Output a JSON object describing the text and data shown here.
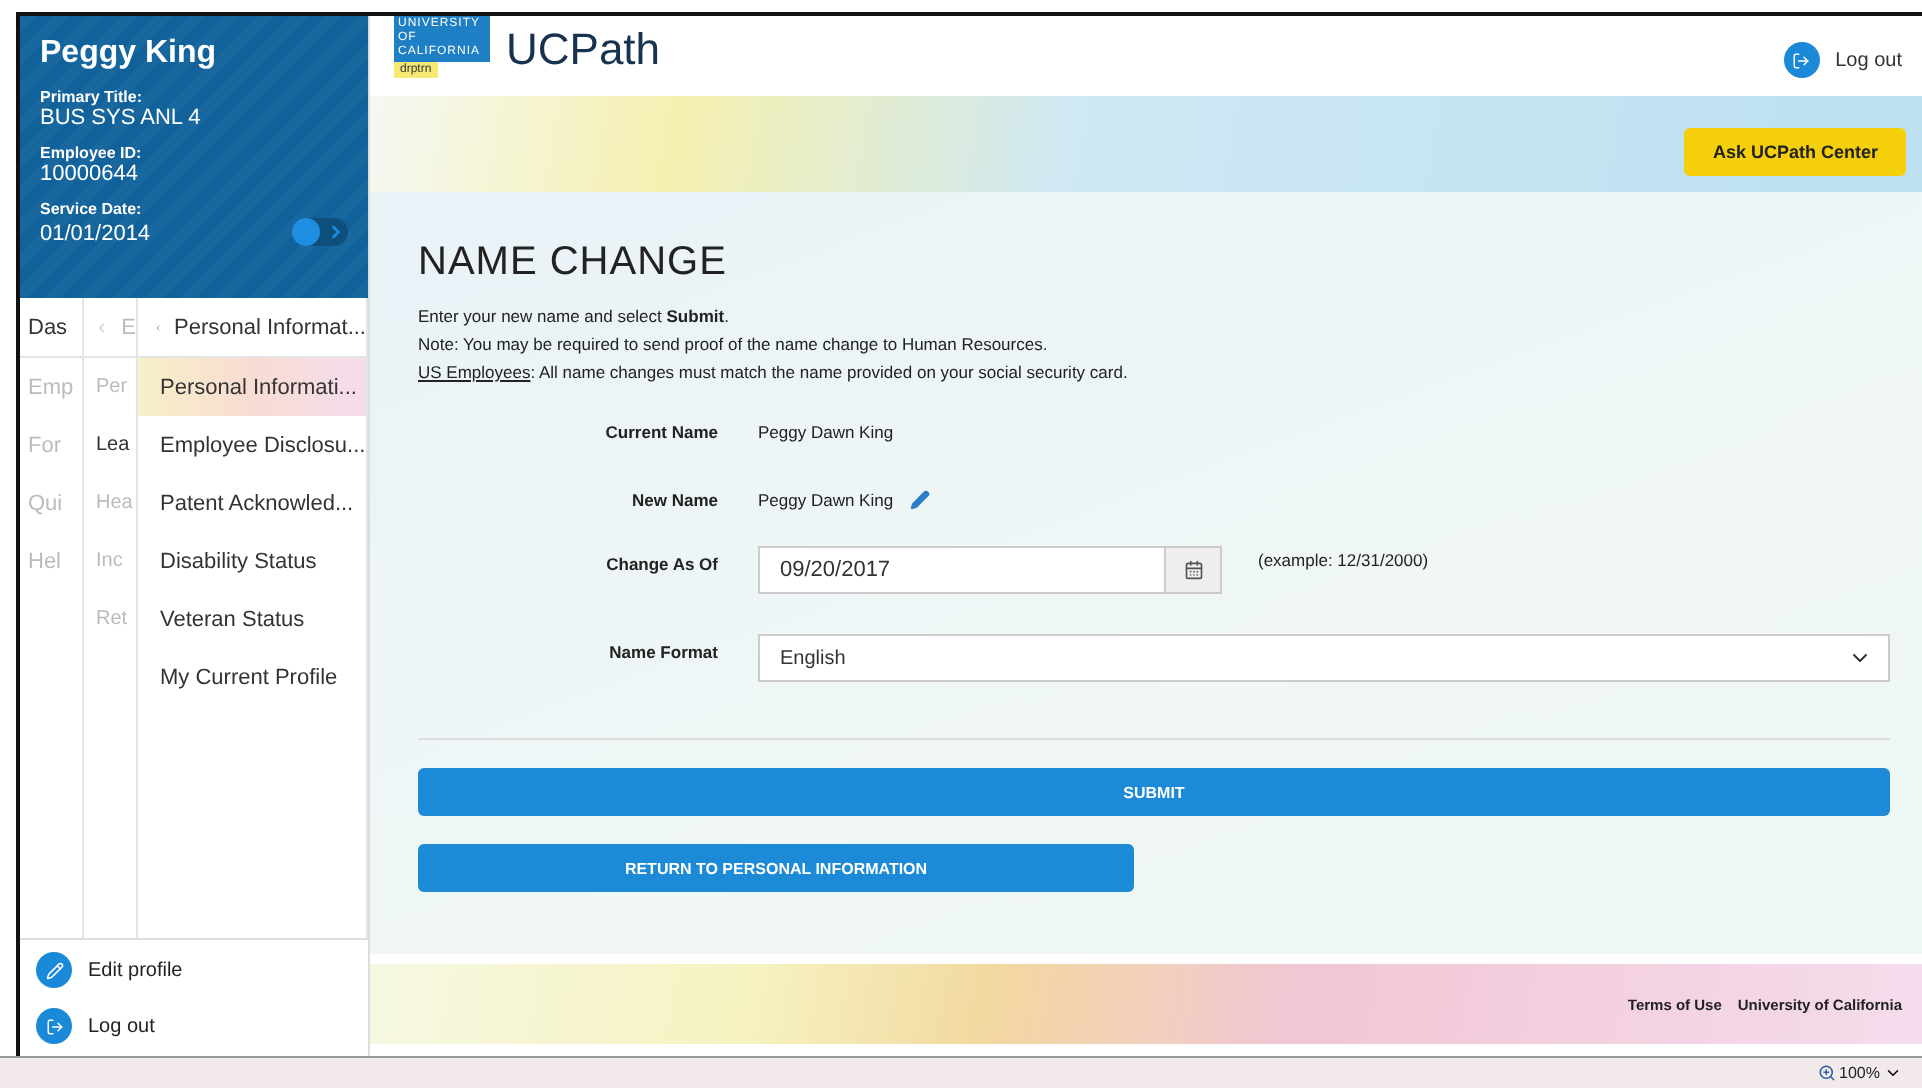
{
  "profile": {
    "name": "Peggy King",
    "fields": [
      {
        "label": "Primary Title:",
        "value": "BUS SYS ANL 4"
      },
      {
        "label": "Employee ID:",
        "value": "10000644"
      },
      {
        "label": "Service Date:",
        "value": "01/01/2014"
      }
    ],
    "toggle": {
      "on": false
    }
  },
  "nav": {
    "columns": [
      {
        "header": "Das",
        "items": [
          {
            "label": "Emp",
            "disabled": true
          },
          {
            "label": "For",
            "disabled": true
          },
          {
            "label": "Qui",
            "disabled": true
          },
          {
            "label": "Hel",
            "disabled": true
          }
        ]
      },
      {
        "header": "E",
        "items": [
          {
            "label": "Per",
            "disabled": true
          },
          {
            "label": "Lea",
            "disabled": false
          },
          {
            "label": "Hea",
            "disabled": true
          },
          {
            "label": "Inc",
            "disabled": true
          },
          {
            "label": "Ret",
            "disabled": true
          }
        ]
      },
      {
        "header": "Personal Informat...",
        "items": [
          {
            "label": "Personal Informati...",
            "selected": true
          },
          {
            "label": "Employee Disclosu...",
            "selected": false
          },
          {
            "label": "Patent Acknowled...",
            "selected": false
          },
          {
            "label": "Disability Status",
            "selected": false
          },
          {
            "label": "Veteran Status",
            "selected": false
          },
          {
            "label": "My Current Profile",
            "selected": false
          }
        ]
      }
    ]
  },
  "sidebar_actions": [
    {
      "kind": "edit",
      "label": "Edit profile"
    },
    {
      "kind": "logout",
      "label": "Log out"
    }
  ],
  "header": {
    "logo_lines": [
      "UNIVERSITY",
      "OF",
      "CALIFORNIA"
    ],
    "logo_tag": "drptrn",
    "app_name": "UCPath",
    "logout": "Log out",
    "ask_button": "Ask UCPath Center"
  },
  "form": {
    "title": "NAME CHANGE",
    "intro": [
      "Enter your new name and select **Submit**.",
      "Note: You may be required to send proof of the name change to Human Resources."
    ],
    "note_link": "US Employees",
    "note_text": ": All name changes must match the name provided on your social security card.",
    "rows": [
      {
        "kind": "text",
        "label": "Current Name",
        "value": "Peggy Dawn King"
      },
      {
        "kind": "editable",
        "label": "New Name",
        "value": "Peggy Dawn King"
      },
      {
        "kind": "date",
        "label": "Change As Of",
        "value": "09/20/2017",
        "hint": "(example: 12/31/2000)"
      },
      {
        "kind": "select",
        "label": "Name Format",
        "value": "English"
      }
    ],
    "submit": "SUBMIT",
    "return": "RETURN TO PERSONAL INFORMATION"
  },
  "footer": {
    "links": [
      "Terms of Use",
      "University of California"
    ]
  },
  "status_bar": {
    "zoom": "100%"
  }
}
